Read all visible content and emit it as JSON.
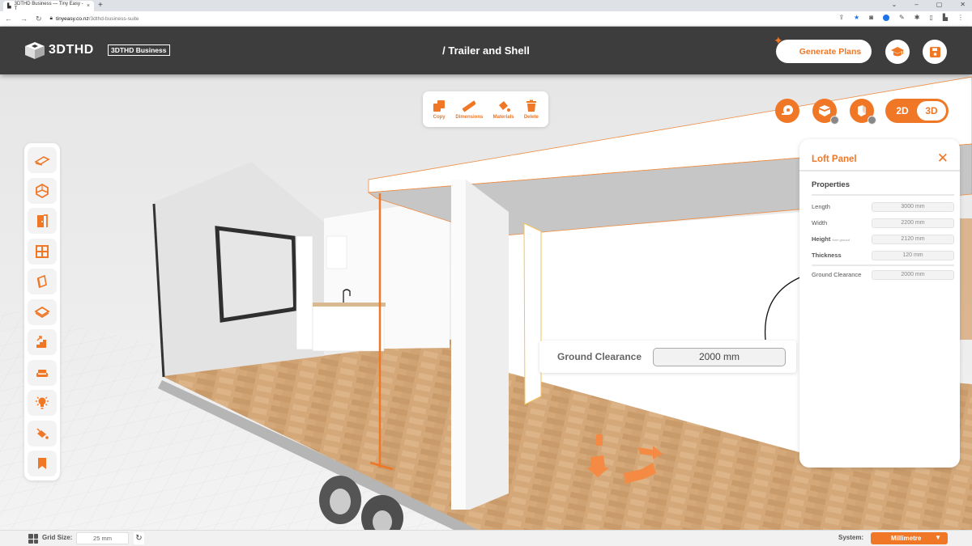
{
  "browser": {
    "tab_title": "3DTHD Business — Tiny Easy - T",
    "tab_close": "×",
    "new_tab": "+",
    "url_host": "tinyeasy.co.nz",
    "url_path": "/3dthd-business-suite",
    "window_controls": [
      "⌄",
      "–",
      "▢",
      "✕"
    ]
  },
  "header": {
    "logo_text": "3DTHD",
    "badge": "3DTHD Business",
    "title": "/ Trailer and Shell",
    "generate_button": "Generate Plans",
    "learn_icon": "graduation-cap-icon",
    "save_icon": "floppy-disk-icon"
  },
  "edit_toolbar": {
    "items": [
      {
        "label": "Copy",
        "icon": "copy-icon"
      },
      {
        "label": "Dimensions",
        "icon": "ruler-icon"
      },
      {
        "label": "Materials",
        "icon": "paint-bucket-icon"
      },
      {
        "label": "Delete",
        "icon": "trash-icon"
      }
    ]
  },
  "view_controls": {
    "buttons": [
      "tape-measure-icon",
      "section-view-icon",
      "wall-visibility-icon"
    ],
    "mode_options": [
      "2D",
      "3D"
    ],
    "active_mode": "3D"
  },
  "sidebar": {
    "items": [
      {
        "name": "trailer",
        "icon": "trailer-icon"
      },
      {
        "name": "shell",
        "icon": "shell-cube-icon"
      },
      {
        "name": "doors",
        "icon": "door-icon"
      },
      {
        "name": "windows",
        "icon": "window-icon"
      },
      {
        "name": "walls",
        "icon": "wall-panel-icon"
      },
      {
        "name": "floors",
        "icon": "floor-icon"
      },
      {
        "name": "stairs",
        "icon": "stairs-icon"
      },
      {
        "name": "furniture",
        "icon": "sofa-icon"
      },
      {
        "name": "lighting",
        "icon": "lightbulb-icon"
      },
      {
        "name": "materials",
        "icon": "paint-bucket-icon"
      },
      {
        "name": "saved",
        "icon": "bookmark-icon"
      }
    ]
  },
  "panel": {
    "title": "Loft Panel",
    "close": "✕",
    "section_title": "Properties",
    "properties": [
      {
        "label": "Length",
        "value": "3000 mm"
      },
      {
        "label": "Width",
        "value": "2200 mm"
      },
      {
        "label": "Height",
        "sublabel": "from ground",
        "value": "2120 mm"
      },
      {
        "label": "Thickness",
        "value": "120 mm"
      }
    ],
    "ground_clearance": {
      "label": "Ground Clearance",
      "value": "2000 mm"
    }
  },
  "callout": {
    "label": "Ground Clearance",
    "value": "2000 mm"
  },
  "footer": {
    "grid_label": "Grid Size:",
    "grid_value": "25 mm",
    "reset_icon": "↻",
    "system_label": "System:",
    "system_value": "Millimetre",
    "system_caret": "▼"
  },
  "colors": {
    "accent": "#ef7726",
    "header_bg": "#3d3d3d",
    "floor": "#d4a373"
  }
}
